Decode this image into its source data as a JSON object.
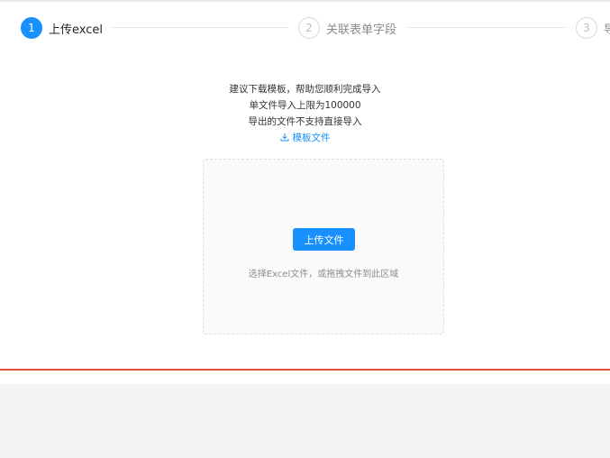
{
  "steps": [
    {
      "number": "1",
      "label": "上传excel",
      "state": "active"
    },
    {
      "number": "2",
      "label": "关联表单字段",
      "state": "inactive"
    },
    {
      "number": "3",
      "label": "导",
      "state": "inactive"
    }
  ],
  "instructions": {
    "line1": "建议下载模板，帮助您顺利完成导入",
    "line2": "单文件导入上限为100000",
    "line3": "导出的文件不支持直接导入"
  },
  "template_link": {
    "icon": "download-icon",
    "label": "模板文件"
  },
  "upload": {
    "button_label": "上传文件",
    "hint": "选择Excel文件，或拖拽文件到此区域"
  },
  "colors": {
    "primary": "#1890ff",
    "divider_red": "#e74c3c",
    "footer_bg": "#f2f3f5"
  }
}
